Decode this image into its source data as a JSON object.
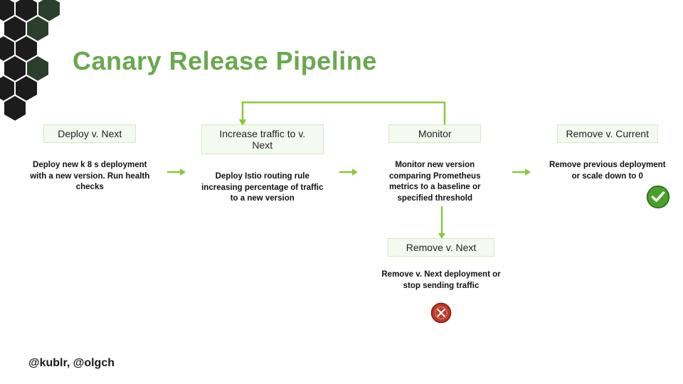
{
  "title": "Canary Release Pipeline",
  "steps": [
    {
      "label": "Deploy v. Next",
      "desc": "Deploy new k 8 s deployment with a new version.\nRun health checks"
    },
    {
      "label": "Increase traffic to v. Next",
      "desc": "Deploy Istio routing rule increasing percentage of traffic to a new version"
    },
    {
      "label": "Monitor",
      "desc": "Monitor new version comparing Prometheus metrics to a baseline or specified threshold"
    },
    {
      "label": "Remove v. Current",
      "desc": "Remove previous deployment or scale down to 0"
    }
  ],
  "fallback": {
    "label": "Remove v. Next",
    "desc": "Remove v. Next deployment or stop sending traffic"
  },
  "footer": "@kublr, @olgch",
  "colors": {
    "accent": "#6aa84f",
    "arrow": "#8cc63f",
    "ok_badge": "#4aa02c",
    "err_badge": "#c0392b"
  }
}
